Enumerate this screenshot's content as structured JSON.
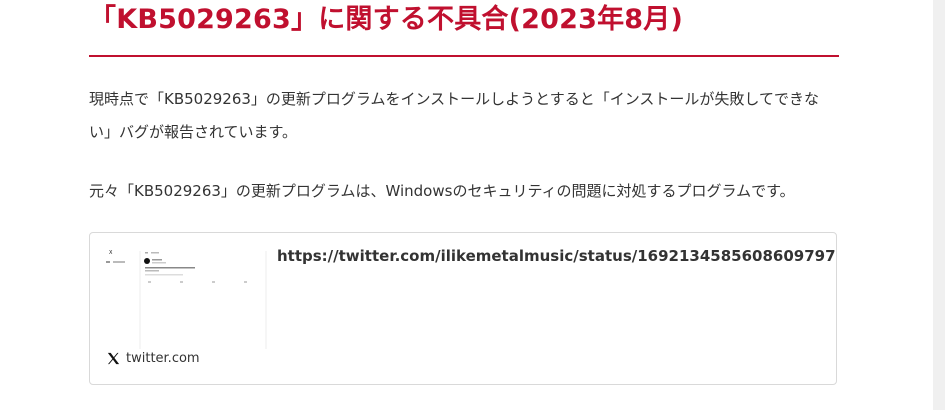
{
  "article": {
    "headline": "「KB5029263」に関する不具合(2023年8月)",
    "paragraph_1": "現時点で「KB5029263」の更新プログラムをインストールしようとすると「インストールが失敗してできない」バグが報告されています。",
    "paragraph_2": "元々「KB5029263」の更新プログラムは、Windowsのセキュリティの問題に対処するプログラムです。"
  },
  "embed": {
    "url": "https://twitter.com/ilikemetalmusic/status/1692134585608609797",
    "domain": "twitter.com",
    "source_icon": "x-logo-icon",
    "thumbnail_icon": "tweet-preview-thumbnail"
  },
  "colors": {
    "accent": "#c0102f",
    "body_text": "#333333",
    "card_border": "#d9d9d9"
  }
}
